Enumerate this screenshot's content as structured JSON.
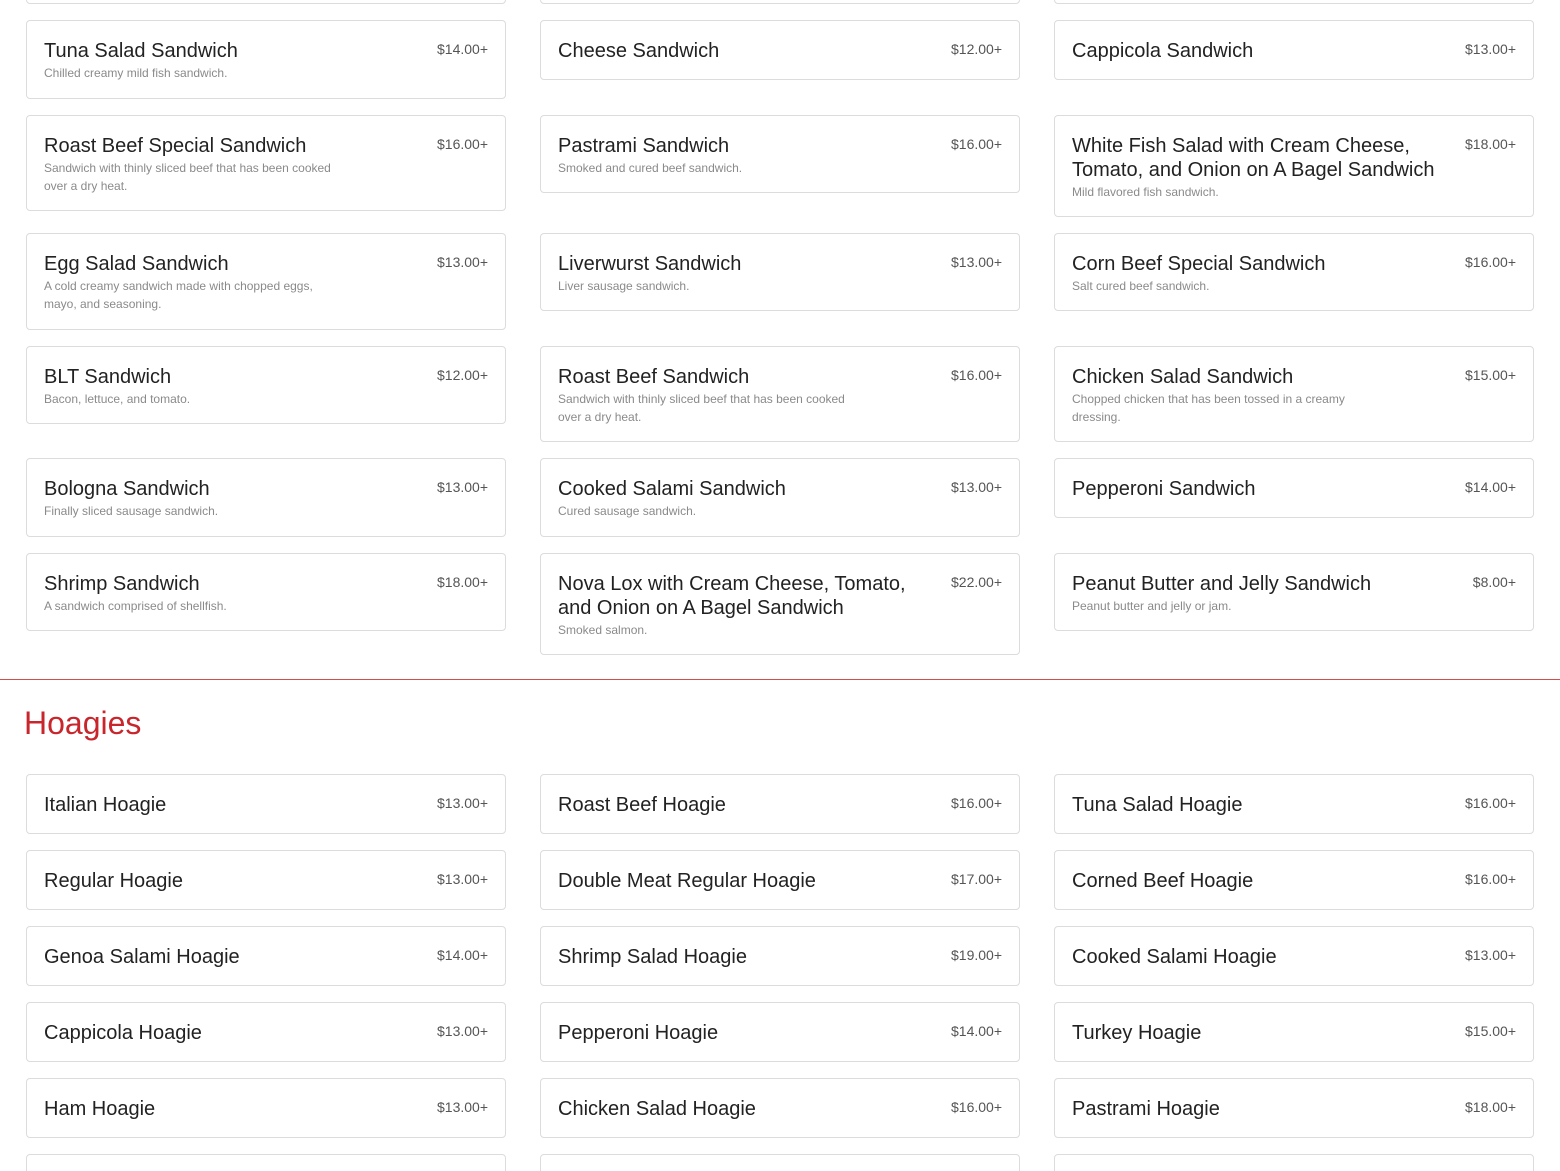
{
  "sandwiches": [
    {
      "name": "Tuna Salad Sandwich",
      "desc": "Chilled creamy mild fish sandwich.",
      "price": "$14.00+"
    },
    {
      "name": "Cheese Sandwich",
      "desc": "",
      "price": "$12.00+"
    },
    {
      "name": "Cappicola Sandwich",
      "desc": "",
      "price": "$13.00+"
    },
    {
      "name": "Roast Beef Special Sandwich",
      "desc": "Sandwich with thinly sliced beef that has been cooked over a dry heat.",
      "price": "$16.00+"
    },
    {
      "name": "Pastrami Sandwich",
      "desc": "Smoked and cured beef sandwich.",
      "price": "$16.00+"
    },
    {
      "name": "White Fish Salad with Cream Cheese, Tomato, and Onion on A Bagel Sandwich",
      "desc": "Mild flavored fish sandwich.",
      "price": "$18.00+"
    },
    {
      "name": "Egg Salad Sandwich",
      "desc": "A cold creamy sandwich made with chopped eggs, mayo, and seasoning.",
      "price": "$13.00+"
    },
    {
      "name": "Liverwurst Sandwich",
      "desc": "Liver sausage sandwich.",
      "price": "$13.00+"
    },
    {
      "name": "Corn Beef Special Sandwich",
      "desc": "Salt cured beef sandwich.",
      "price": "$16.00+"
    },
    {
      "name": "BLT Sandwich",
      "desc": "Bacon, lettuce, and tomato.",
      "price": "$12.00+"
    },
    {
      "name": "Roast Beef Sandwich",
      "desc": "Sandwich with thinly sliced beef that has been cooked over a dry heat.",
      "price": "$16.00+"
    },
    {
      "name": "Chicken Salad Sandwich",
      "desc": "Chopped chicken that has been tossed in a creamy dressing.",
      "price": "$15.00+"
    },
    {
      "name": "Bologna Sandwich",
      "desc": "Finally sliced sausage sandwich.",
      "price": "$13.00+"
    },
    {
      "name": "Cooked Salami Sandwich",
      "desc": "Cured sausage sandwich.",
      "price": "$13.00+"
    },
    {
      "name": "Pepperoni Sandwich",
      "desc": "",
      "price": "$14.00+"
    },
    {
      "name": "Shrimp Sandwich",
      "desc": "A sandwich comprised of shellfish.",
      "price": "$18.00+"
    },
    {
      "name": "Nova Lox with Cream Cheese, Tomato, and Onion on A Bagel Sandwich",
      "desc": "Smoked salmon.",
      "price": "$22.00+"
    },
    {
      "name": "Peanut Butter and Jelly Sandwich",
      "desc": "Peanut butter and jelly or jam.",
      "price": "$8.00+"
    }
  ],
  "hoagies_section": {
    "title": "Hoagies"
  },
  "hoagies": [
    {
      "name": "Italian Hoagie",
      "price": "$13.00+"
    },
    {
      "name": "Roast Beef Hoagie",
      "price": "$16.00+"
    },
    {
      "name": "Tuna Salad Hoagie",
      "price": "$16.00+"
    },
    {
      "name": "Regular Hoagie",
      "price": "$13.00+"
    },
    {
      "name": "Double Meat Regular Hoagie",
      "price": "$17.00+"
    },
    {
      "name": "Corned Beef Hoagie",
      "price": "$16.00+"
    },
    {
      "name": "Genoa Salami Hoagie",
      "price": "$14.00+"
    },
    {
      "name": "Shrimp Salad Hoagie",
      "price": "$19.00+"
    },
    {
      "name": "Cooked Salami Hoagie",
      "price": "$13.00+"
    },
    {
      "name": "Cappicola Hoagie",
      "price": "$13.00+"
    },
    {
      "name": "Pepperoni Hoagie",
      "price": "$14.00+"
    },
    {
      "name": "Turkey Hoagie",
      "price": "$15.00+"
    },
    {
      "name": "Ham Hoagie",
      "price": "$13.00+"
    },
    {
      "name": "Chicken Salad Hoagie",
      "price": "$16.00+"
    },
    {
      "name": "Pastrami Hoagie",
      "price": "$18.00+"
    }
  ],
  "colors": {
    "accent": "#c8262c",
    "divider": "#d94b4b",
    "border": "#dcdcdc"
  }
}
